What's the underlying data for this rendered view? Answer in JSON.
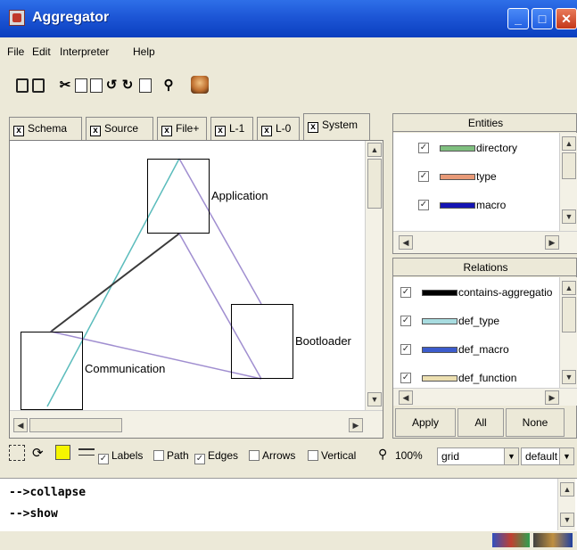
{
  "window": {
    "title": "Aggregator"
  },
  "menu": [
    "File",
    "Edit",
    "Interpreter",
    "Help"
  ],
  "toolbar_icons": [
    "save-icon",
    "save-all-icon",
    "cut-icon",
    "copy-icon",
    "paste-icon",
    "undo-icon",
    "redo-icon",
    "zoom-fit-icon",
    "find-icon",
    "interpreter-face-icon"
  ],
  "tabs": [
    {
      "label": "Schema"
    },
    {
      "label": "Source"
    },
    {
      "label": "File+"
    },
    {
      "label": "L-1"
    },
    {
      "label": "L-0"
    },
    {
      "label": "System"
    }
  ],
  "graph": {
    "nodes": [
      {
        "id": "application",
        "label": "Application"
      },
      {
        "id": "bootloader",
        "label": "Bootloader"
      },
      {
        "id": "communication",
        "label": "Communication"
      }
    ],
    "edge_colors": {
      "black": "#3a3a3a",
      "teal": "#5bbcbc",
      "purple": "#a08ed0"
    }
  },
  "entities": {
    "header": "Entities",
    "items": [
      {
        "label": "directory",
        "checked": true,
        "color": "#7fbf7f"
      },
      {
        "label": "type",
        "checked": true,
        "color": "#e89a78"
      },
      {
        "label": "macro",
        "checked": true,
        "color": "#1414b4"
      }
    ]
  },
  "relations": {
    "header": "Relations",
    "items": [
      {
        "label": "contains-aggregatio",
        "checked": true,
        "color": "#000000"
      },
      {
        "label": "def_type",
        "checked": true,
        "color": "#a8dce0"
      },
      {
        "label": "def_macro",
        "checked": true,
        "color": "#3c5ccc"
      },
      {
        "label": "def_function",
        "checked": true,
        "color": "#ecdfb0"
      }
    ]
  },
  "buttons": {
    "apply": "Apply",
    "all": "All",
    "none": "None"
  },
  "options": {
    "labels": "Labels",
    "labels_checked": true,
    "path": "Path",
    "path_checked": false,
    "edges": "Edges",
    "edges_checked": true,
    "arrows": "Arrows",
    "arrows_checked": false,
    "vertical": "Vertical",
    "vertical_checked": false,
    "zoom": "100%",
    "layout": "grid",
    "scheme": "default"
  },
  "console": {
    "lines": [
      "-->collapse",
      "-->show"
    ]
  },
  "status_icons": [
    "status-chart-icon",
    "status-tools-icon"
  ]
}
